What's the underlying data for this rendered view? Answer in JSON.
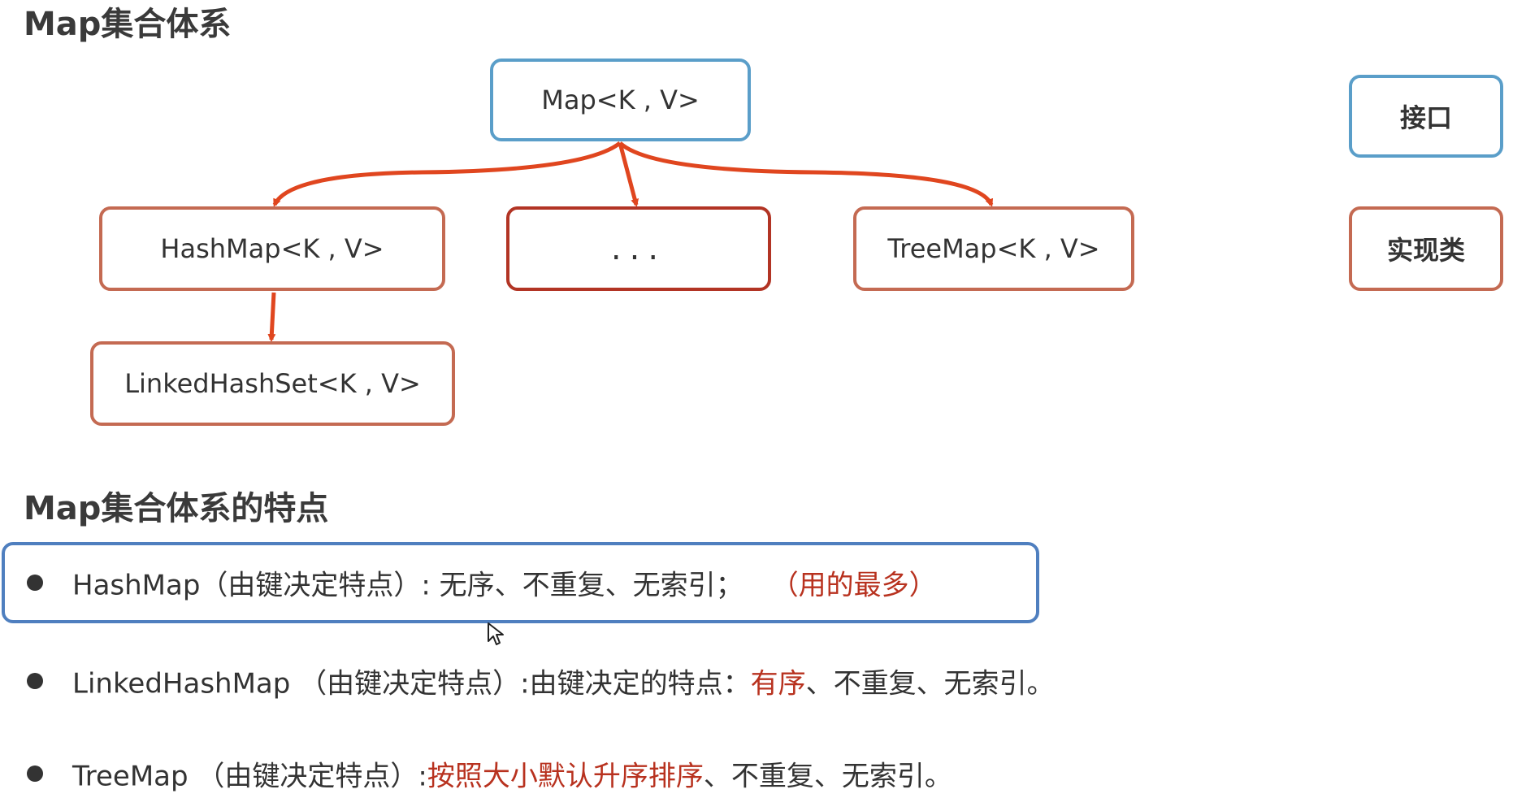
{
  "section1_title": "Map集合体系",
  "section2_title": "Map集合体系的特点",
  "nodes": {
    "map": "Map<K , V>",
    "hashmap": "HashMap<K , V>",
    "more": "...",
    "treemap": "TreeMap<K , V>",
    "linked": "LinkedHashSet<K , V>"
  },
  "legend": {
    "interface": "接口",
    "impl": "实现类"
  },
  "features": [
    {
      "prefix": "HashMap（由键决定特点）: 无序、不重复、无索引；",
      "highlight": "（用的最多）",
      "suffix": ""
    },
    {
      "prefix": "LinkedHashMap （由键决定特点）:由键决定的特点：",
      "highlight": "有序",
      "suffix": "、不重复、无索引。"
    },
    {
      "prefix": "TreeMap （由键决定特点）:",
      "highlight": "按照大小默认升序排序",
      "suffix": "、不重复、无索引。"
    }
  ],
  "colors": {
    "interface_border": "#5a9ec9",
    "impl_border": "#c46a52",
    "arrow": "#e0461f",
    "highlight_text": "#b8321f",
    "selection_box": "#4f7fbf"
  },
  "icons": {
    "cursor": "mouse-pointer-icon",
    "bullet": "bullet-dot-icon"
  }
}
